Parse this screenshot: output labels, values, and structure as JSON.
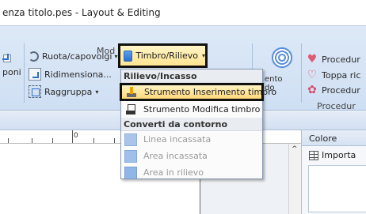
{
  "window": {
    "title": "enza titolo.pes - Layout & Editing"
  },
  "ribbon": {
    "left_partial_label": "poni",
    "rotate_label": "Ruota/capovolgi",
    "resize_label": "Ridimensiona...",
    "group_label": "Raggruppa",
    "group_section_label": "Mod",
    "timbro_button_label": "Timbro/Rilievo",
    "right_items": [
      {
        "label": "Procedur",
        "icon": "heart-icon"
      },
      {
        "label": "Toppa ric",
        "icon": "heart-outline-icon"
      },
      {
        "label": "Procedur",
        "icon": "flower-icon"
      }
    ],
    "right_section_label": "Procedur",
    "behind_menu_partial_1": "ento",
    "behind_menu_partial_2": "do"
  },
  "menu": {
    "section1": "Rilievo/Incasso",
    "items1": [
      {
        "label": "Strumento Inserimento timbro",
        "icon": "stamp-icon",
        "highlight": true
      },
      {
        "label": "Strumento Modifica timbro",
        "icon": "stamp-edit-icon"
      }
    ],
    "section2": "Converti da contorno",
    "items2": [
      {
        "label": "Linea incassata",
        "icon": "line-icon",
        "disabled": true
      },
      {
        "label": "Area incassata",
        "icon": "area-icon",
        "disabled": true
      },
      {
        "label": "Area in rilievo",
        "icon": "relief-icon",
        "disabled": true
      }
    ]
  },
  "ruler": {
    "zero_label": "0"
  },
  "right_panel": {
    "tab_label": "Colore",
    "import_label": "Importa"
  },
  "colors": {
    "highlight_outline": "#111111",
    "menu_highlight": "#ffd97a",
    "ribbon_bg": "#dde9f7"
  }
}
